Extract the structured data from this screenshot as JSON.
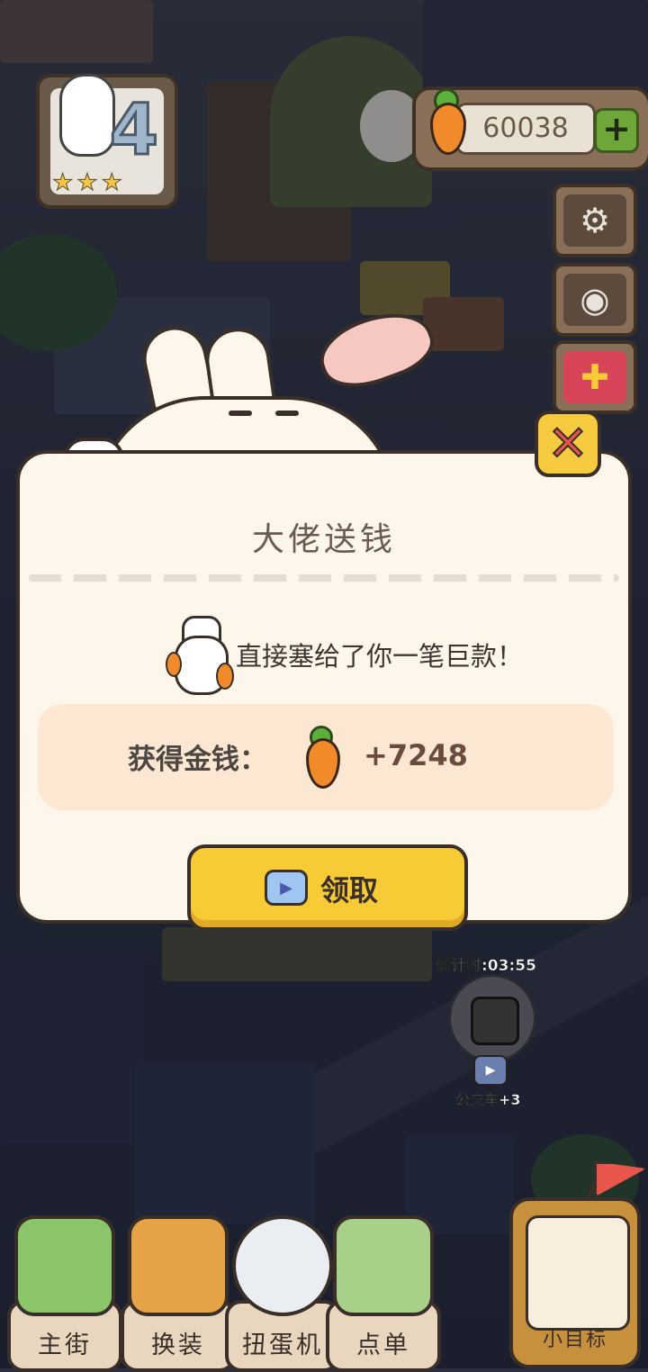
{
  "hud": {
    "level": "4",
    "level_stars": "★★★",
    "money": "60038",
    "add_label": "+"
  },
  "dialog": {
    "title": "大佬送钱",
    "message": "直接塞给了你一笔巨款！",
    "reward_label": "获得金钱：",
    "reward_value": "+7248",
    "claim_label": "领取",
    "close_symbol": "✕"
  },
  "bus": {
    "timer": "倒计时:03:55",
    "label": "公交车+3"
  },
  "nav": {
    "items": [
      {
        "label": "主街",
        "icon": "map-icon"
      },
      {
        "label": "换装",
        "icon": "paint-roller-icon"
      },
      {
        "label": "扭蛋机",
        "icon": "gacha-machine-icon"
      },
      {
        "label": "点单",
        "icon": "order-list-icon"
      }
    ],
    "goal_label": "小目标"
  },
  "colors": {
    "accent_yellow": "#f7cb36",
    "close_red": "#e8564b",
    "card_bg": "#fdf6ea",
    "reward_bg": "#fbe7d2"
  }
}
